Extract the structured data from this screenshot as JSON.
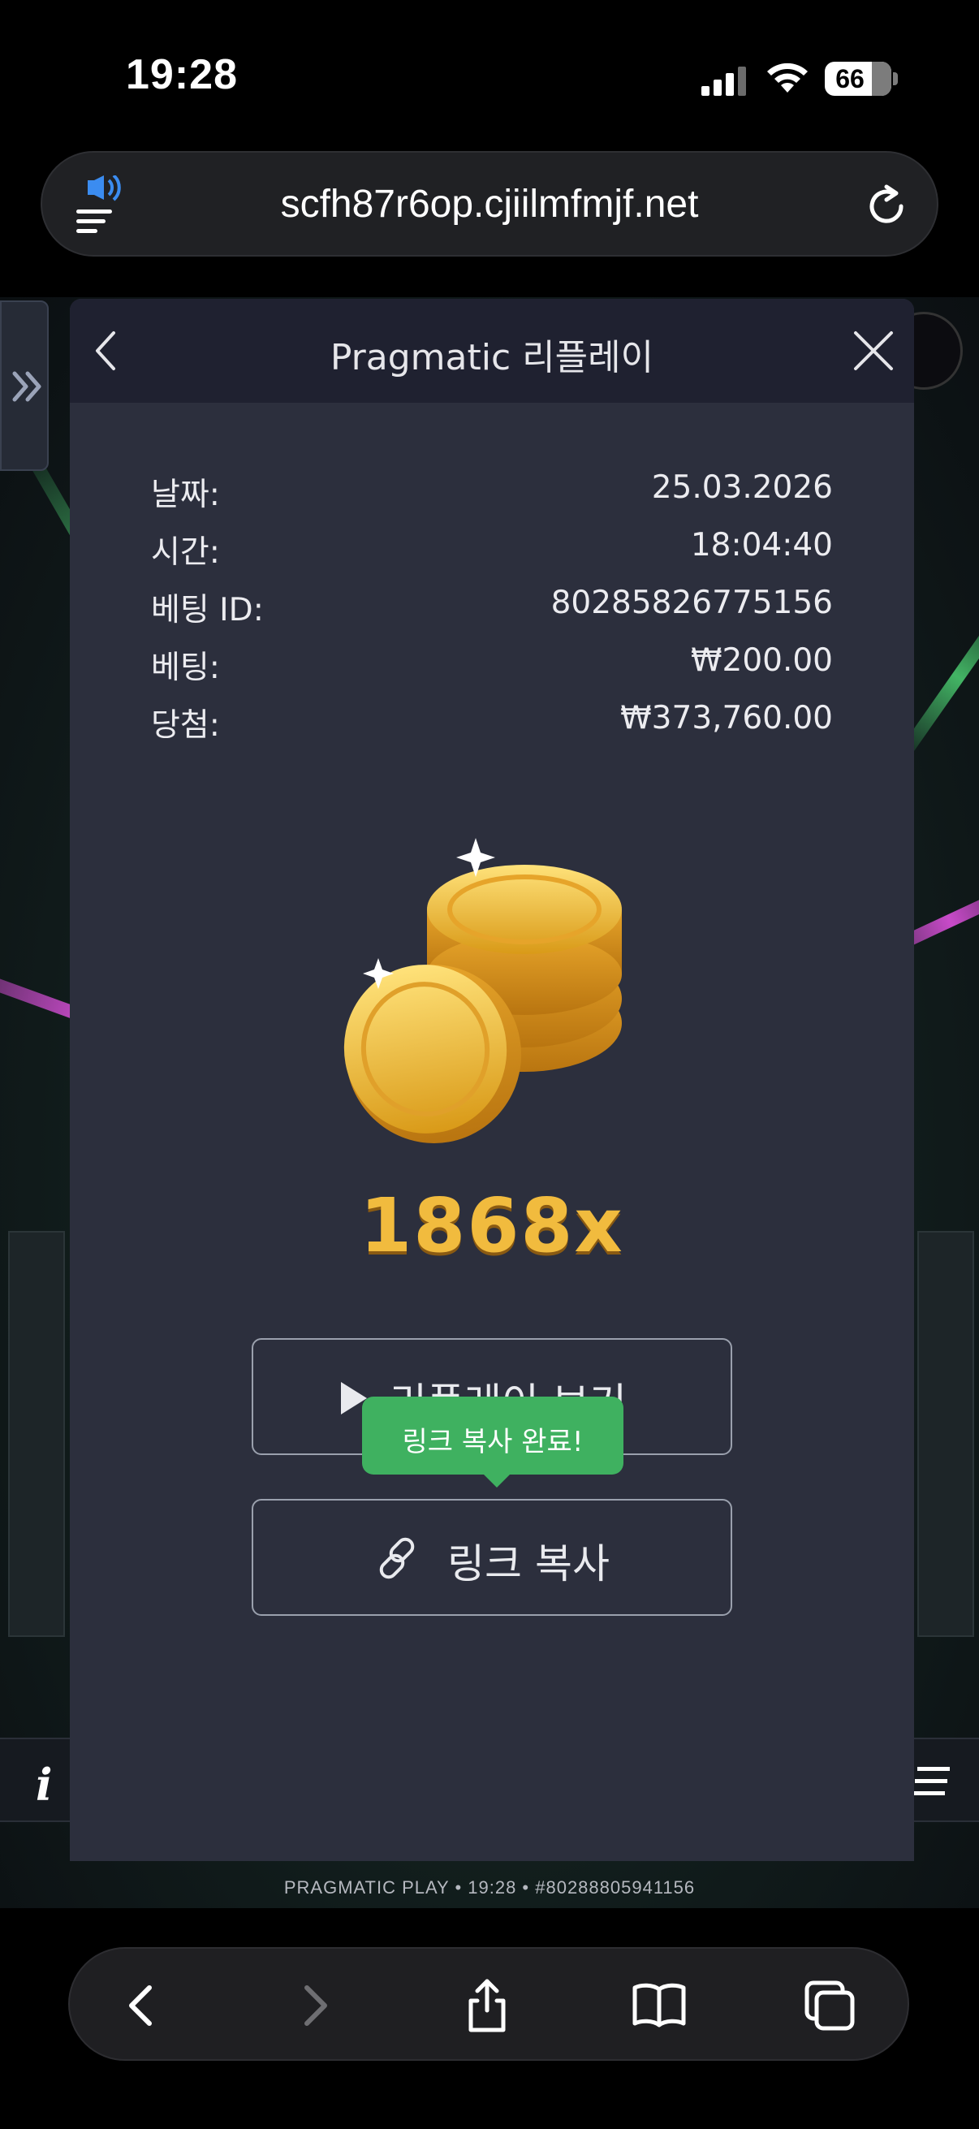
{
  "status_bar": {
    "time": "19:28",
    "battery": "66"
  },
  "browser": {
    "url": "scfh87r6op.cjiilmfmjf.net"
  },
  "modal": {
    "title": "Pragmatic 리플레이",
    "rows": [
      {
        "label": "날짜:",
        "value": "25.03.2026"
      },
      {
        "label": "시간:",
        "value": "18:04:40"
      },
      {
        "label": "베팅 ID:",
        "value": "80285826775156"
      },
      {
        "label": "베팅:",
        "value": "₩200.00"
      },
      {
        "label": "당첨:",
        "value": "₩373,760.00"
      }
    ],
    "multiplier": "1868x",
    "replay_button": "리플레이 보기",
    "copy_button": "링크 복사",
    "toast": "링크 복사 완료!"
  },
  "game": {
    "footer_text": "PRAGMATIC PLAY • 19:28 • #80288805941156"
  },
  "colors": {
    "modal_bg": "#2c2f3d",
    "toast": "#3fb160",
    "multiplier": "#f1bb3e"
  }
}
